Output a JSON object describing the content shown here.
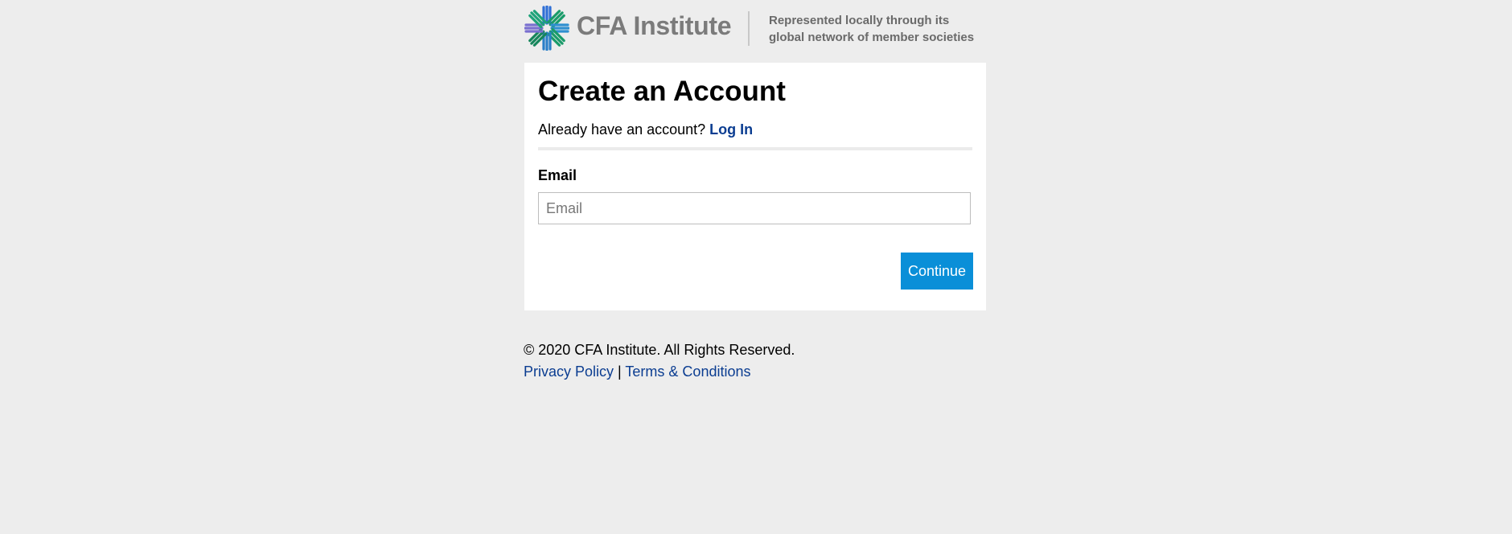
{
  "header": {
    "brand_name": "CFA Institute",
    "tagline_line1": "Represented locally through its",
    "tagline_line2": "global network of member societies",
    "logo_icon": "cfa-starburst-icon",
    "colors": {
      "logo_blue": "#2f6fd6",
      "logo_green": "#1a9b6a",
      "logo_purple": "#7a6fd0",
      "brand_gray": "#7b7b7b"
    }
  },
  "form": {
    "title": "Create an Account",
    "already_text": "Already have an account?",
    "login_link": "Log In",
    "email_label": "Email",
    "email_placeholder": "Email",
    "email_value": "",
    "continue_label": "Continue",
    "colors": {
      "button_bg": "#0a8fd8",
      "link": "#0b3d91"
    }
  },
  "footer": {
    "copyright": "© 2020 CFA Institute. All Rights Reserved.",
    "privacy_link": "Privacy Policy",
    "separator": "|",
    "terms_link": "Terms & Conditions"
  }
}
